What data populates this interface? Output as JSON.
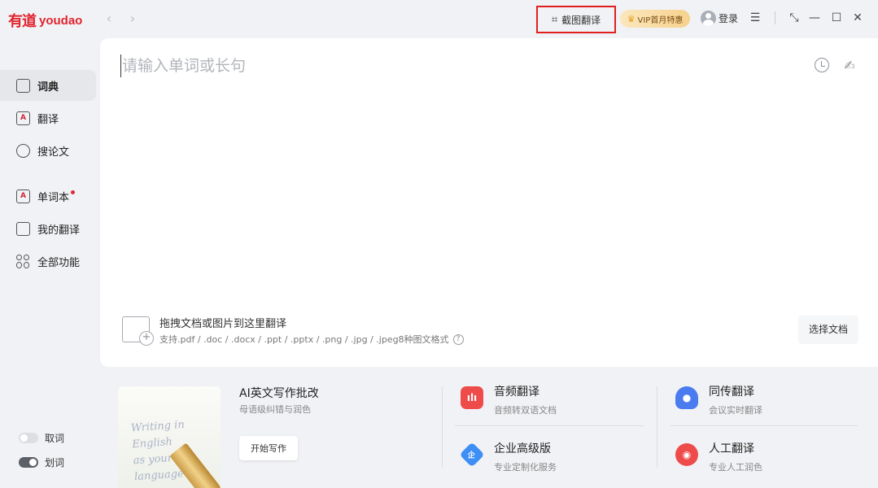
{
  "app": {
    "logo_cn": "有道",
    "logo_en": "youdao"
  },
  "titlebar": {
    "back_icon": "chevron-left-icon",
    "forward_icon": "chevron-right-icon",
    "screenshot_translate": "截图翻译",
    "vip_label": "VIP首月特惠",
    "login_label": "登录",
    "accent_red": "#e02020"
  },
  "sidebar": {
    "items": [
      {
        "label": "词典",
        "icon": "dictionary-icon"
      },
      {
        "label": "翻译",
        "icon": "translate-icon"
      },
      {
        "label": "搜论文",
        "icon": "search-paper-icon"
      },
      {
        "label": "单词本",
        "icon": "wordbook-icon"
      },
      {
        "label": "我的翻译",
        "icon": "my-translation-icon"
      },
      {
        "label": "全部功能",
        "icon": "all-features-icon"
      }
    ],
    "toggles": [
      {
        "label": "取词",
        "state": "off"
      },
      {
        "label": "划词",
        "state": "on"
      }
    ]
  },
  "main": {
    "input_placeholder": "请输入单词或长句",
    "drop_title": "拖拽文档或图片到这里翻译",
    "drop_sub": "支持.pdf / .doc / .docx / .ppt / .pptx / .png / .jpg / .jpeg8种图文格式",
    "choose_button": "选择文档"
  },
  "features": {
    "ai_writing": {
      "title": "AI英文写作批改",
      "sub": "母语级纠错与润色",
      "button": "开始写作",
      "card_text": [
        "Writing in",
        "English",
        "as your",
        "language"
      ]
    },
    "items": [
      {
        "title": "音频翻译",
        "sub": "音频转双语文档",
        "color": "#ee4b4b"
      },
      {
        "title": "同传翻译",
        "sub": "会议实时翻译",
        "color": "#4a7cf0"
      },
      {
        "title": "企业高级版",
        "sub": "专业定制化服务",
        "color": "#3d8ef5"
      },
      {
        "title": "人工翻译",
        "sub": "专业人工润色",
        "color": "#ee4b4b"
      }
    ]
  }
}
